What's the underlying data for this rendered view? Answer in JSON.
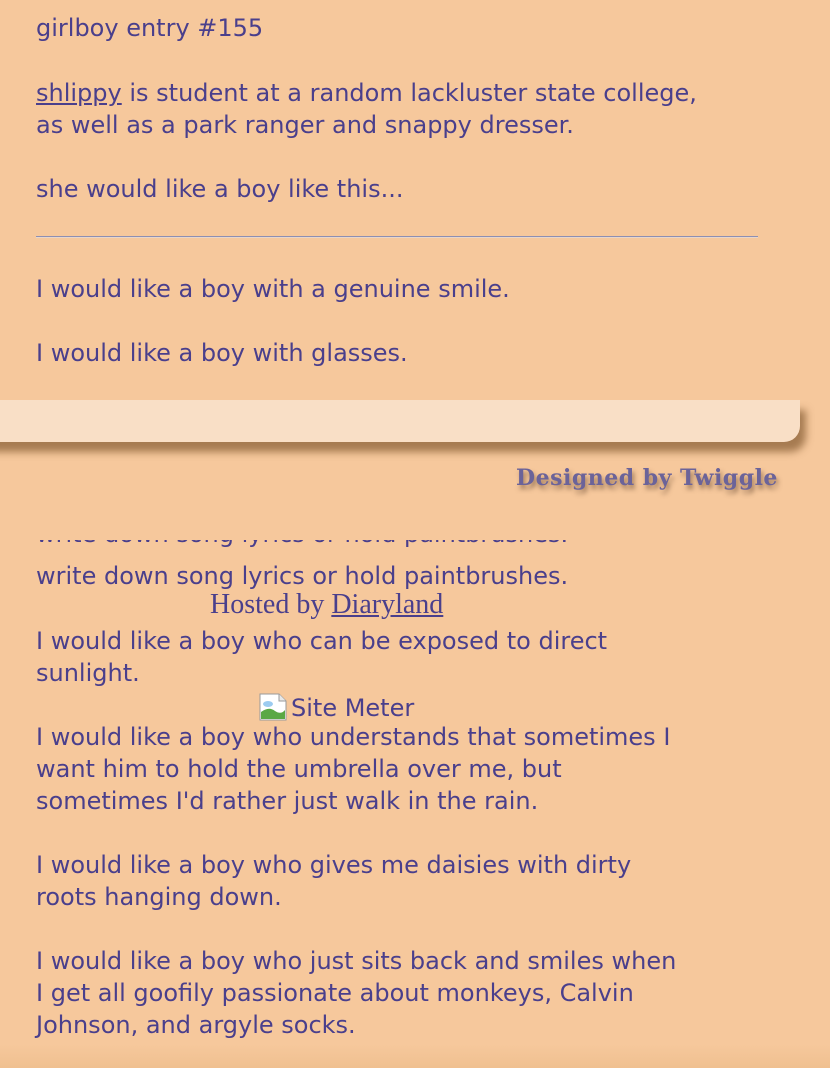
{
  "entry": {
    "title": "girlboy entry #155",
    "author_link": "shlippy",
    "intro_line1": " is student at a random lackluster state college,",
    "intro_line2": "as well as a park ranger and snappy dresser.",
    "intro_line3": "she would like a boy like this...",
    "wish1": "I would like a boy with a genuine smile.",
    "wish2": "I would like a boy with glasses.",
    "wish3_line2": "write down song lyrics or hold paintbrushes.",
    "wish4_line1": "I would like a boy who can be exposed to direct",
    "wish4_line2": "sunlight.",
    "wish5_line1": "I would like a boy who understands that sometimes I",
    "wish5_line2": "want him to hold the umbrella over me, but",
    "wish5_line3": "sometimes I'd rather just walk in the rain.",
    "wish6_line1": "I would like a boy who gives me daisies with dirty",
    "wish6_line2": "roots hanging down.",
    "wish7_line1": "I would like a boy who just sits back and smiles when",
    "wish7_line2": "I get all goofily passionate about monkeys, Calvin",
    "wish7_line3": "Johnson, and argyle socks."
  },
  "footer": {
    "designed_by": "Designed by Twiggle",
    "hosted_prefix": "Hosted by ",
    "hosted_link": "Diaryland",
    "site_meter_alt": "Site Meter"
  },
  "colors": {
    "background": "#f6c89c",
    "text": "#4a3f8c",
    "panel": "#f9dfc6"
  }
}
